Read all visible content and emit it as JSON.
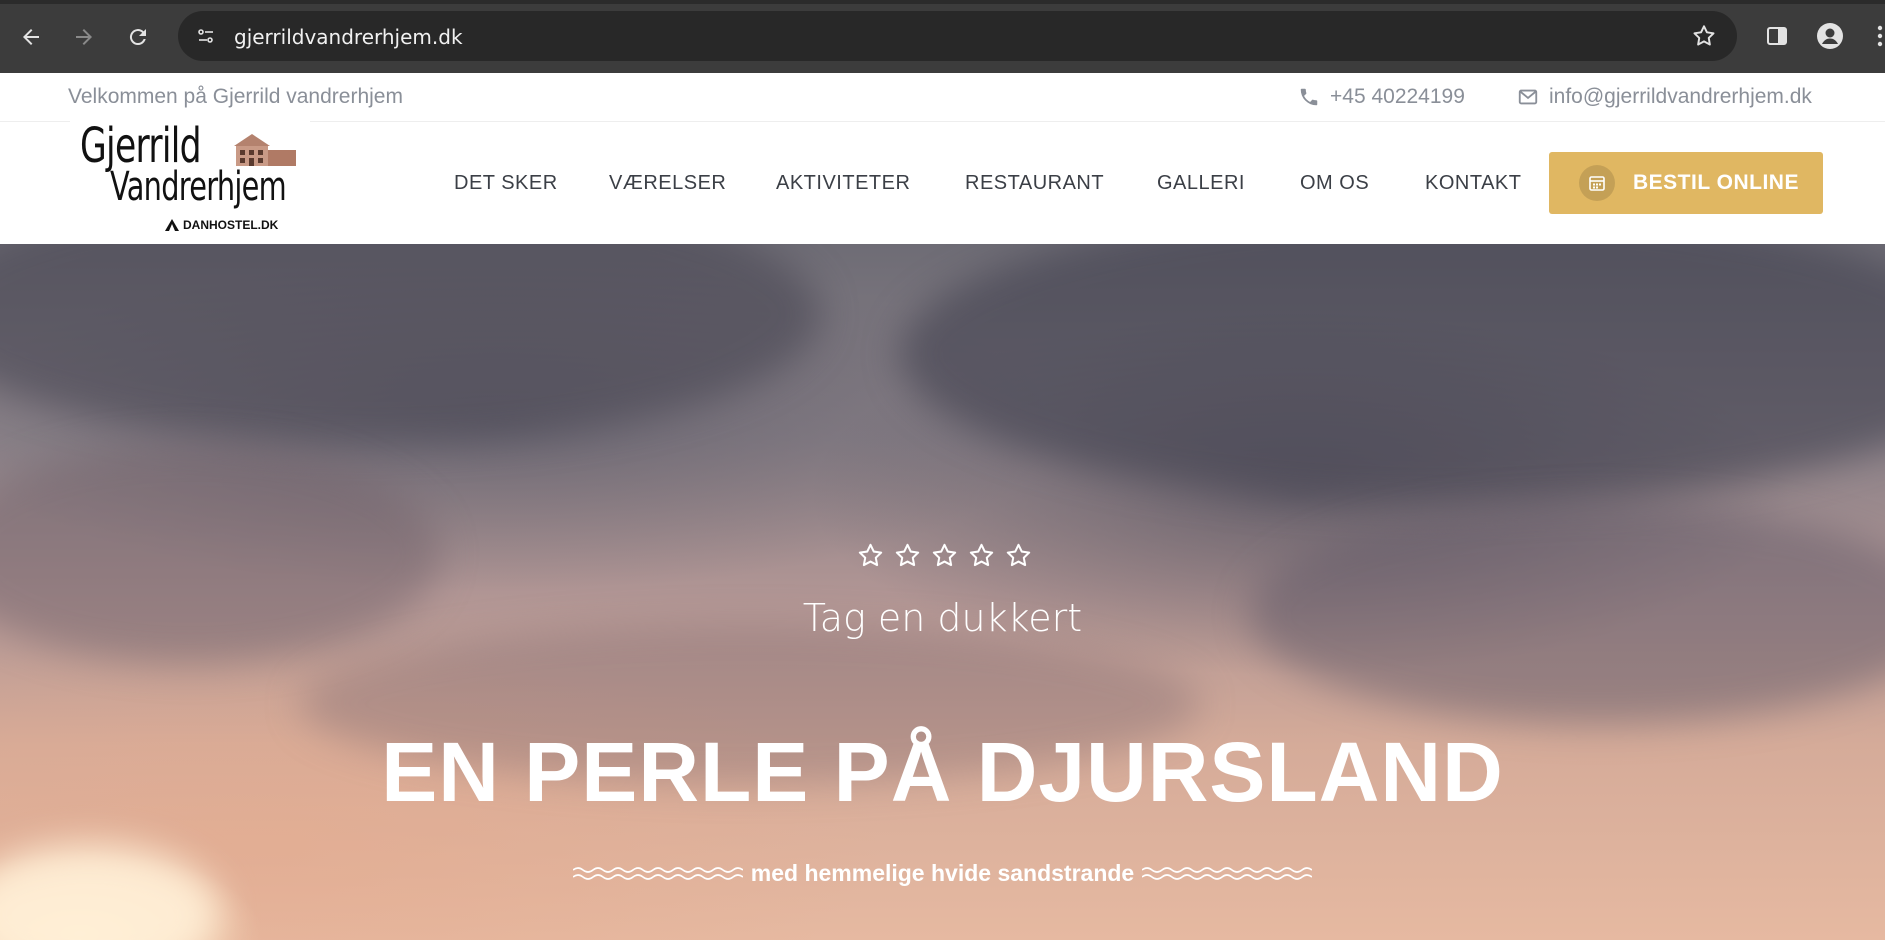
{
  "browser": {
    "url": "gjerrildvandrerhjem.dk"
  },
  "topbar": {
    "welcome": "Velkommen på Gjerrild vandrerhjem",
    "phone": "+45 40224199",
    "email": "info@gjerrildvandrerhjem.dk"
  },
  "logo": {
    "line1": "Gjerrild",
    "line2": "Vandrerhjem",
    "sub": "DANHOSTEL.DK"
  },
  "nav": {
    "items": [
      "DET SKER",
      "VÆRELSER",
      "AKTIVITETER",
      "RESTAURANT",
      "GALLERI",
      "OM OS",
      "KONTAKT"
    ],
    "cta": "BESTIL ONLINE"
  },
  "hero": {
    "rating_stars": 5,
    "subtitle": "Tag en dukkert",
    "headline": "EN PERLE PÅ DJURSLAND",
    "tagline": "med hemmelige hvide sandstrande"
  },
  "colors": {
    "accent": "#e0b762",
    "nav_text": "#3b3f46",
    "muted_text": "#8a8f98",
    "chrome": "#3c3c3c"
  }
}
